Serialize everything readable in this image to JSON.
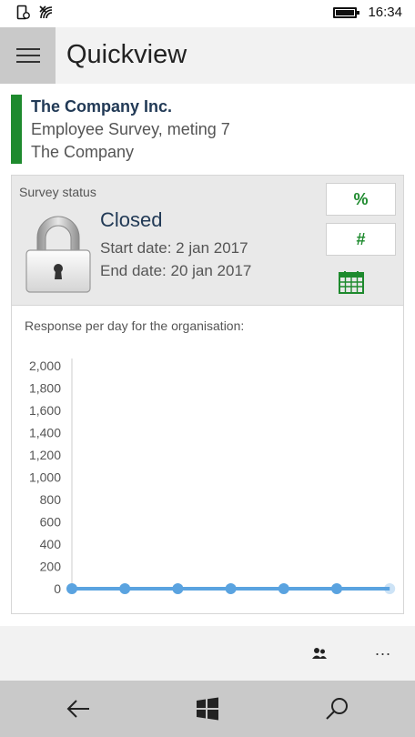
{
  "status_bar": {
    "time": "16:34",
    "icons": [
      "screen-rotation-icon",
      "wifi-icon",
      "battery-icon"
    ]
  },
  "app_bar": {
    "title": "Quickview",
    "menu_icon": "hamburger-icon"
  },
  "company": {
    "name": "The Company Inc.",
    "survey": "Employee Survey, meting 7",
    "organisation": "The Company",
    "accent_color": "#1e8a2e"
  },
  "survey_status": {
    "label": "Survey status",
    "state": "Closed",
    "start_date": "Start date: 2 jan 2017",
    "end_date": "End date: 20 jan 2017",
    "buttons": {
      "percent": "%",
      "number": "#",
      "calendar_icon": "calendar-icon"
    }
  },
  "chart_data": {
    "type": "line",
    "title": "Response per day for the organisation:",
    "xlabel": "",
    "ylabel": "",
    "ylim": [
      0,
      2000
    ],
    "y_ticks": [
      "2,000",
      "1,800",
      "1,600",
      "1,400",
      "1,200",
      "1,000",
      "800",
      "600",
      "400",
      "200",
      "0"
    ],
    "series": [
      {
        "values": [
          0,
          0,
          0,
          0,
          0,
          0,
          0
        ]
      }
    ],
    "color": "#5aa3e0"
  },
  "command_bar": {
    "people_icon": "people-icon",
    "more": "..."
  },
  "nav_bar": {
    "back_icon": "back-arrow-icon",
    "windows_icon": "windows-logo-icon",
    "search_icon": "search-icon"
  }
}
